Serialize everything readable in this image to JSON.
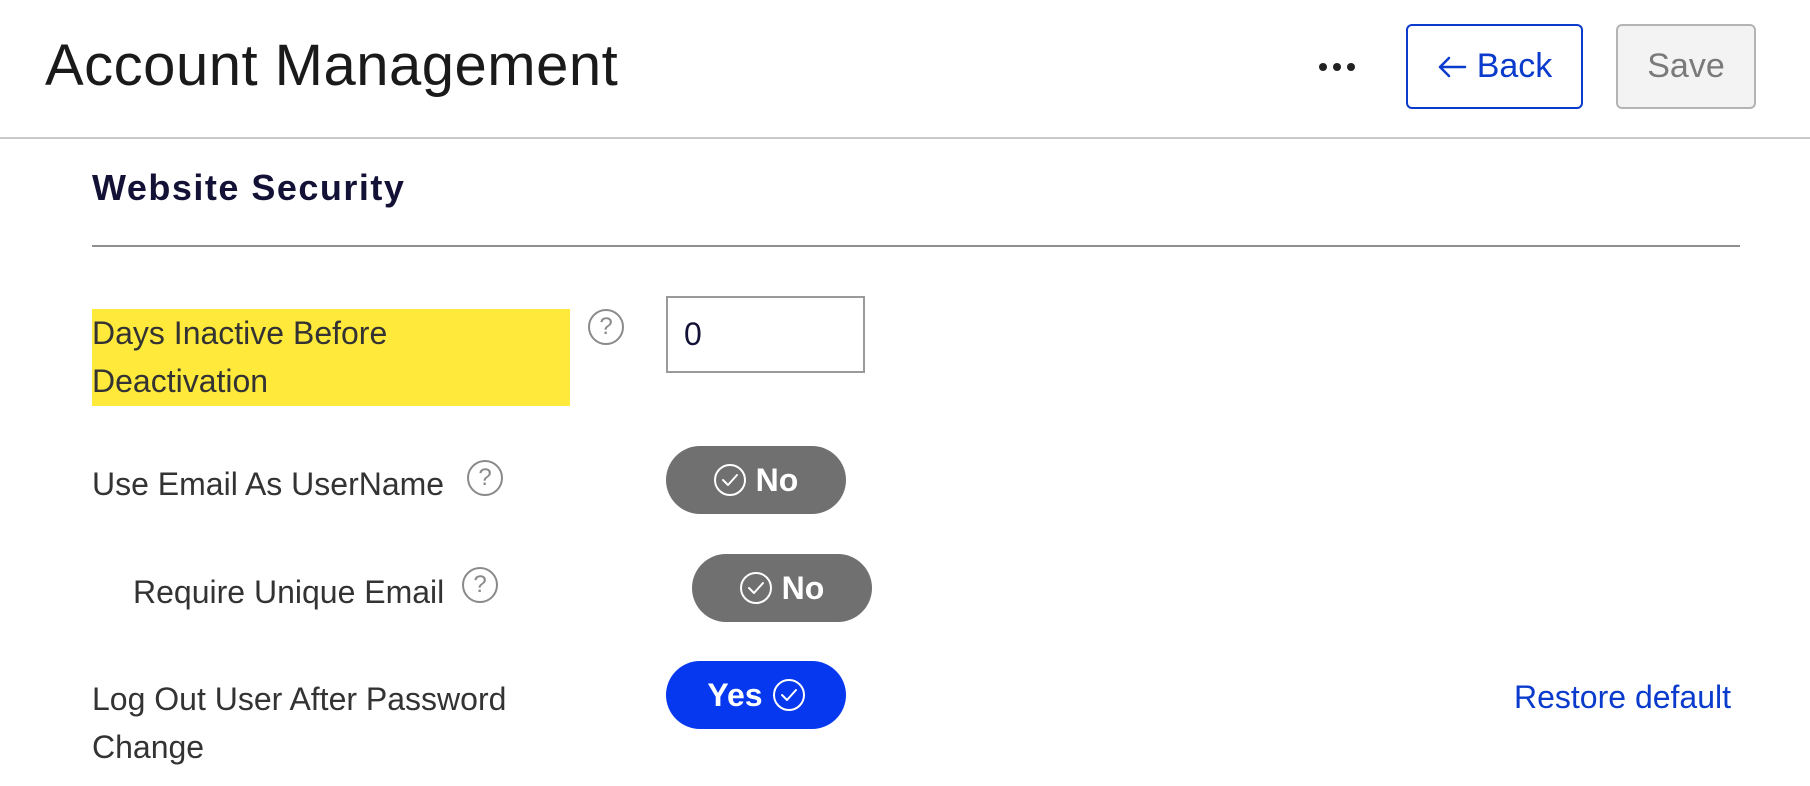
{
  "header": {
    "title": "Account Management",
    "back_label": "Back",
    "save_label": "Save"
  },
  "section": {
    "title": "Website Security"
  },
  "settings": {
    "days_inactive": {
      "label_line1": "Days Inactive Before",
      "label_line2": "Deactivation",
      "value": "0",
      "help": "?"
    },
    "email_as_username": {
      "label": "Use Email As UserName",
      "toggle": "No",
      "help": "?"
    },
    "require_unique_email": {
      "label": "Require Unique Email",
      "toggle": "No",
      "help": "?"
    },
    "logout_after_password": {
      "label_line1": "Log Out User After Password",
      "label_line2": "Change",
      "toggle": "Yes",
      "restore_label": "Restore default"
    }
  },
  "icons": {
    "more": "ellipsis-icon",
    "back_arrow": "arrow-left-icon",
    "help": "question-circle-icon",
    "check": "check-circle-icon"
  },
  "colors": {
    "accent": "#0a3bcc",
    "toggle_on": "#0638ef",
    "toggle_off": "#707070",
    "highlight": "#ffe93b",
    "title_dark": "#131236"
  }
}
